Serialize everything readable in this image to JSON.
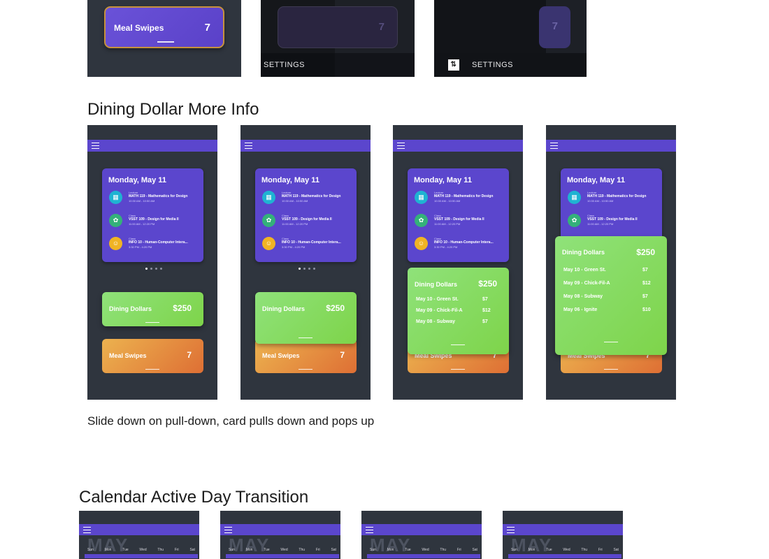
{
  "top_row": {
    "card1": {
      "label": "Meal Swipes",
      "value": "7"
    },
    "card2": {
      "value": "7",
      "settings_label": "SETTINGS"
    },
    "card3": {
      "value": "7",
      "settings_label": "SETTINGS",
      "settings_icon": "swap-vertical-icon"
    }
  },
  "section1": {
    "title": "Dining Dollar More Info",
    "caption": "Slide down on pull-down, card pulls down and pops up"
  },
  "schedule": {
    "date": "Monday, May 11",
    "events": [
      {
        "type": "Lecture",
        "title": "MATH 119 - Mathematics for Design",
        "time": "10:30 AM - 10:50 AM",
        "icon": "calculator-icon",
        "color": "#1fb3d2"
      },
      {
        "type": "Class",
        "title": "VSST 109 - Design for Media II",
        "time": "11:00 AM - 12:20 PM",
        "icon": "palette-icon",
        "color": "#34b17a"
      },
      {
        "type": "Class",
        "title": "INFO 10 - Human-Computer Intera...",
        "time": "3:30 PM - 4:20 PM",
        "icon": "people-icon",
        "color": "#f0b324"
      }
    ]
  },
  "dining": {
    "label": "Dining Dollars",
    "amount": "$250",
    "transactions_short": [
      {
        "label": "May 10 - Green St.",
        "amount": "$7"
      },
      {
        "label": "May 09 - Chick-Fil-A",
        "amount": "$12"
      },
      {
        "label": "May 08 - Subway",
        "amount": "$7"
      }
    ],
    "transactions_full": [
      {
        "label": "May 10 - Green St.",
        "amount": "$7"
      },
      {
        "label": "May 09 - Chick-Fil-A",
        "amount": "$12"
      },
      {
        "label": "May 08 - Subway",
        "amount": "$7"
      },
      {
        "label": "May 06 - Ignite",
        "amount": "$10"
      }
    ]
  },
  "meal_swipes": {
    "label": "Meal Swipes",
    "value": "7"
  },
  "section2": {
    "title": "Calendar Active Day Transition",
    "month": "MAY",
    "weekdays": [
      "Sun",
      "Mon",
      "Tue",
      "Wed",
      "Thu",
      "Fri",
      "Sat"
    ]
  }
}
